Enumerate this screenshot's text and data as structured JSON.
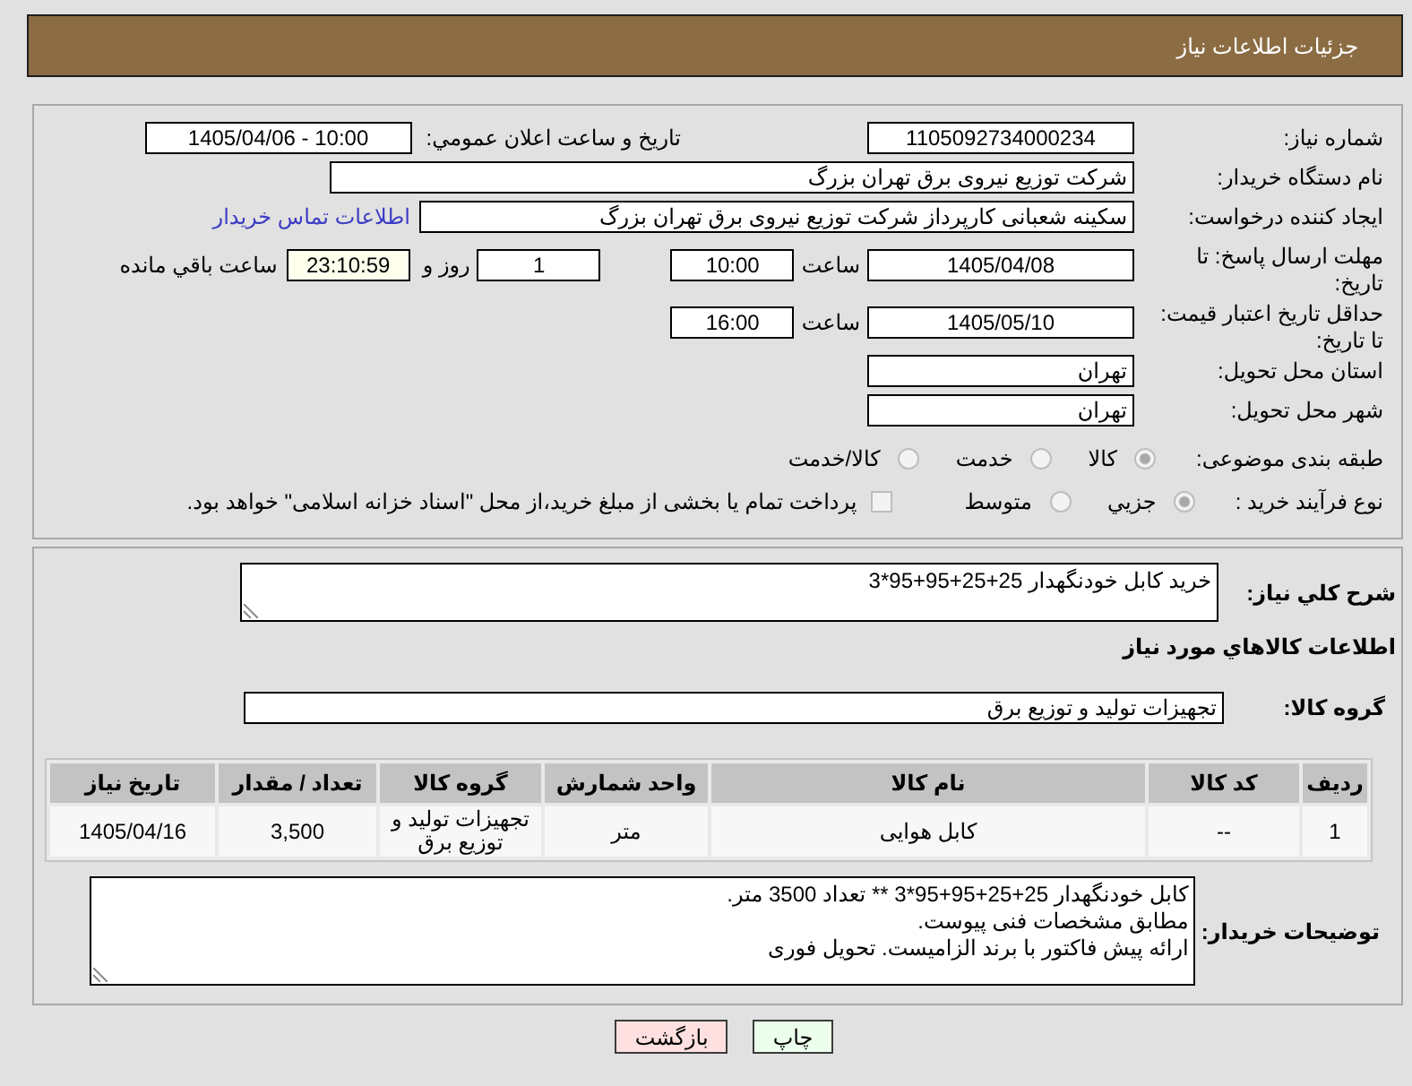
{
  "header": {
    "title": "جزئیات اطلاعات نیاز"
  },
  "need_info": {
    "need_number": {
      "label": "شماره نیاز:",
      "value": "1105092734000234"
    },
    "announce_datetime": {
      "label": "تاریخ و ساعت اعلان عمومي:",
      "value": "1405/04/06 - 10:00"
    },
    "buyer_org": {
      "label": "نام دستگاه خریدار:",
      "value": "شرکت توزیع نیروی برق تهران بزرگ"
    },
    "requester": {
      "label": "ایجاد کننده درخواست:",
      "value": "سکینه شعبانی کارپرداز شرکت توزیع نیروی برق تهران بزرگ",
      "contact_link": "اطلاعات تماس خریدار"
    },
    "reply_deadline": {
      "label": "مهلت ارسال پاسخ: تا تاریخ:",
      "date": "1405/04/08",
      "time_label": "ساعت",
      "time": "10:00",
      "days": "1",
      "days_label": "روز و",
      "remaining_time": "23:10:59",
      "remaining_label": "ساعت باقي مانده"
    },
    "price_validity": {
      "label": "حداقل تاریخ اعتبار قیمت: تا تاریخ:",
      "date": "1405/05/10",
      "time_label": "ساعت",
      "time": "16:00"
    },
    "delivery_province": {
      "label": "استان محل تحویل:",
      "value": "تهران"
    },
    "delivery_city": {
      "label": "شهر محل تحویل:",
      "value": "تهران"
    },
    "subject_category": {
      "label": "طبقه بندی موضوعی:",
      "options": [
        {
          "label": "کالا",
          "selected": true
        },
        {
          "label": "خدمت",
          "selected": false
        },
        {
          "label": "کالا/خدمت",
          "selected": false
        }
      ]
    },
    "purchase_process": {
      "label": "نوع فرآیند خرید :",
      "options": [
        {
          "label": "جزيي",
          "selected": true
        },
        {
          "label": "متوسط",
          "selected": false
        }
      ],
      "treasury_payment": {
        "label": "پرداخت تمام یا بخشی از مبلغ خرید،از محل \"اسناد خزانه اسلامی\" خواهد بود.",
        "checked": false
      }
    }
  },
  "goods": {
    "summary": {
      "label": "شرح كلي نياز:",
      "value": "خرید کابل خودنگهدار 25+25+95+95*3"
    },
    "items_heading": "اطلاعات كالاهاي مورد نياز",
    "group": {
      "label": "گروه کالا:",
      "value": "تجهیزات تولید و توزیع برق"
    },
    "table": {
      "columns": [
        "ردیف",
        "کد کالا",
        "نام کالا",
        "واحد شمارش",
        "گروه کالا",
        "تعداد / مقدار",
        "تاریخ نیاز"
      ],
      "rows": [
        [
          "1",
          "--",
          "کابل هوایی",
          "متر",
          "تجهیزات تولید و توزیع برق",
          "3,500",
          "1405/04/16"
        ]
      ]
    },
    "buyer_notes": {
      "label": "توضیحات خریدار:",
      "value": "کابل خودنگهدار 25+25+95+95*3 ** تعداد 3500 متر.\nمطابق مشخصات فنی پیوست.\nارائه پیش فاکتور با برند الزامیست. تحویل فوری"
    }
  },
  "buttons": [
    {
      "label": "چاپ",
      "kind": "print"
    },
    {
      "label": "بازگشت",
      "kind": "back"
    }
  ]
}
